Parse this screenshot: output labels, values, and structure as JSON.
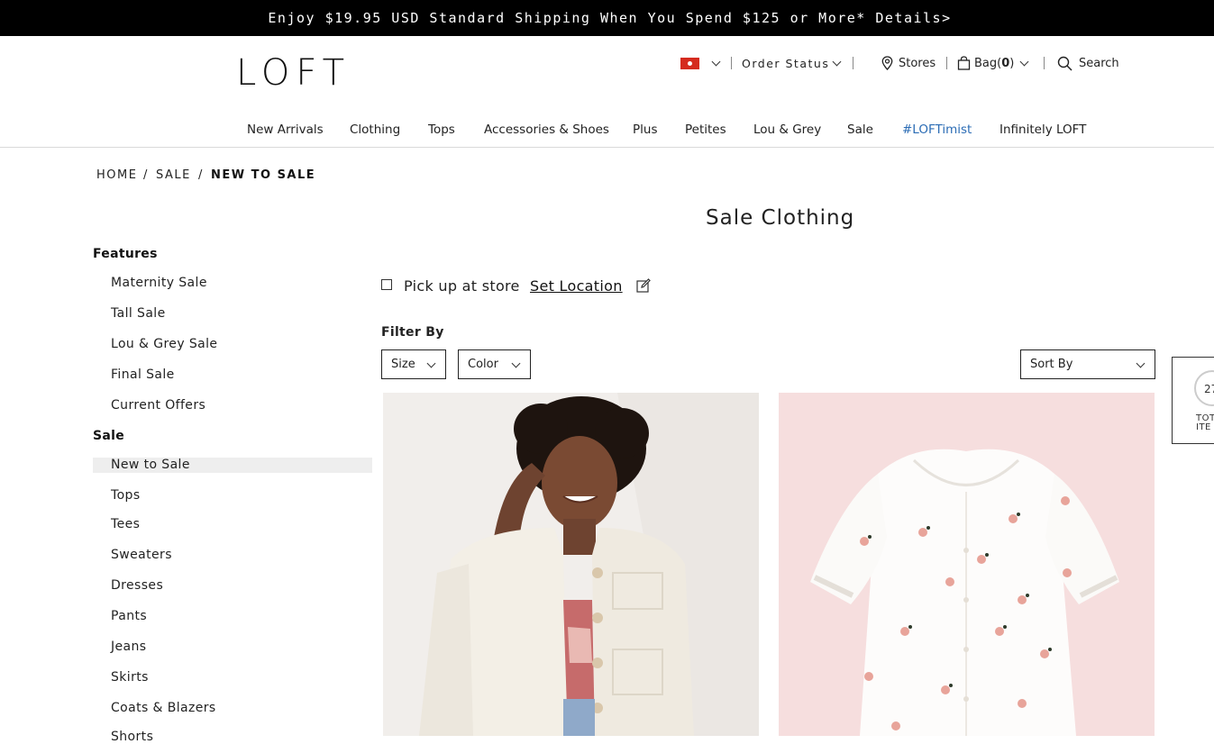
{
  "promo": {
    "text": "Enjoy $19.95 USD Standard Shipping When You Spend $125 or More* Details>"
  },
  "header": {
    "logo": "LOFT",
    "order_status": "Order Status",
    "stores": "Stores",
    "bag": "Bag(",
    "bag_count": "0",
    "bag_close": ")",
    "search": "Search",
    "flag_icon": "hong-kong-flag-icon",
    "flag_color": "#d52b1e"
  },
  "nav": {
    "items": [
      "New Arrivals",
      "Clothing",
      "Tops",
      "Accessories & Shoes",
      "Plus",
      "Petites",
      "Lou & Grey",
      "Sale",
      "#LOFTimist",
      "Infinitely LOFT"
    ],
    "accent_color": "#2b6cb5"
  },
  "breadcrumb": [
    "HOME",
    "SALE",
    "NEW TO SALE"
  ],
  "page_title": "Sale Clothing",
  "sidebar": {
    "features_heading": "Features",
    "features": [
      "Maternity Sale",
      "Tall Sale",
      "Lou & Grey Sale",
      "Final Sale",
      "Current Offers"
    ],
    "sale_heading": "Sale",
    "sale_items": [
      "New to Sale",
      "Tops",
      "Tees",
      "Sweaters",
      "Dresses",
      "Pants",
      "Jeans",
      "Skirts",
      "Coats & Blazers",
      "Shorts"
    ]
  },
  "pickup": {
    "label": "Pick up at store",
    "link": "Set Location"
  },
  "filters": {
    "heading": "Filter By",
    "size": "Size",
    "color": "Color",
    "sort": "Sort By"
  },
  "products": [
    {
      "image": "model-in-white-utility-jacket",
      "background": "#f1eeeb"
    },
    {
      "image": "white-floral-embroidered-puff-sleeve-top",
      "background": "#f6dede"
    }
  ],
  "widget": {
    "count": "27",
    "label_line1": "TOT",
    "label_line2": "ITE"
  }
}
